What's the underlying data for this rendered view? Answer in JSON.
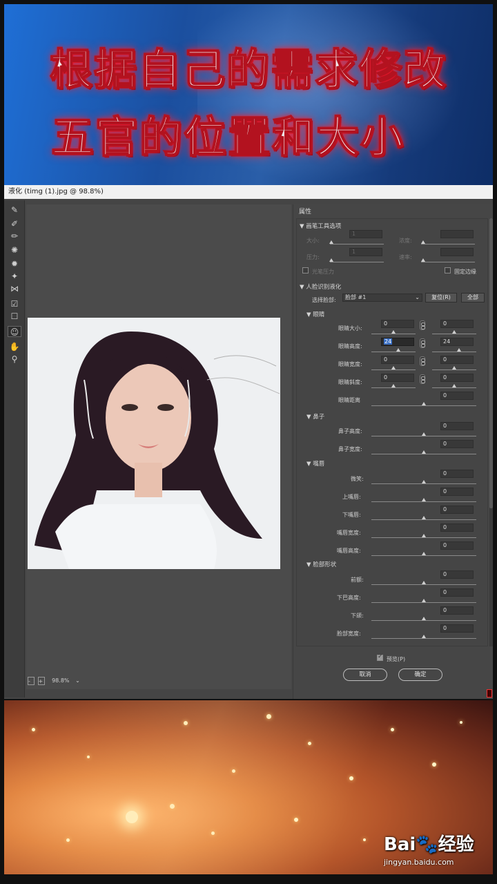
{
  "banner": {
    "line1": "根据自己的需求修改",
    "line2": "五官的位置和大小"
  },
  "window": {
    "title": "液化 (timg (1).jpg @ 98.8%)"
  },
  "canvas": {
    "zoom": "98.8%"
  },
  "panel": {
    "title": "属性",
    "brush": {
      "header": "画笔工具选项",
      "size": "大小:",
      "density": "浓度:",
      "pressure": "压力:",
      "rate": "速率:",
      "pen_pressure": "光笔压力",
      "pin_edges": "固定边缘",
      "size_value": "1",
      "pressure_value": "1"
    },
    "face": {
      "header": "人脸识别液化",
      "select_face_label": "选择脸部:",
      "select_face_value": "脸部 #1",
      "reset_button": "复位(R)",
      "all_button": "全部"
    },
    "eyes": {
      "header": "眼睛",
      "rows": [
        {
          "label": "眼睛大小:",
          "left": "0",
          "right": "0"
        },
        {
          "label": "眼睛高度:",
          "left": "24",
          "right": "24"
        },
        {
          "label": "眼睛宽度:",
          "left": "0",
          "right": "0"
        },
        {
          "label": "眼睛斜度:",
          "left": "0",
          "right": "0"
        },
        {
          "label": "眼睛距离",
          "left": "",
          "right": "0"
        }
      ]
    },
    "nose": {
      "header": "鼻子",
      "rows": [
        {
          "label": "鼻子高度:",
          "value": "0"
        },
        {
          "label": "鼻子宽度:",
          "value": "0"
        }
      ]
    },
    "mouth": {
      "header": "嘴唇",
      "rows": [
        {
          "label": "微笑:",
          "value": "0"
        },
        {
          "label": "上嘴唇:",
          "value": "0"
        },
        {
          "label": "下嘴唇:",
          "value": "0"
        },
        {
          "label": "嘴唇宽度:",
          "value": "0"
        },
        {
          "label": "嘴唇高度:",
          "value": "0"
        }
      ]
    },
    "face_shape": {
      "header": "脸部形状",
      "rows": [
        {
          "label": "前额:",
          "value": "0"
        },
        {
          "label": "下巴高度:",
          "value": "0"
        },
        {
          "label": "下颌:",
          "value": "0"
        },
        {
          "label": "脸部宽度:",
          "value": "0"
        }
      ]
    },
    "preview": "预览(P)",
    "cancel": "取消",
    "ok": "确定"
  },
  "watermark": {
    "main": "Bai🐾经验",
    "sub": "jingyan.baidu.com"
  }
}
